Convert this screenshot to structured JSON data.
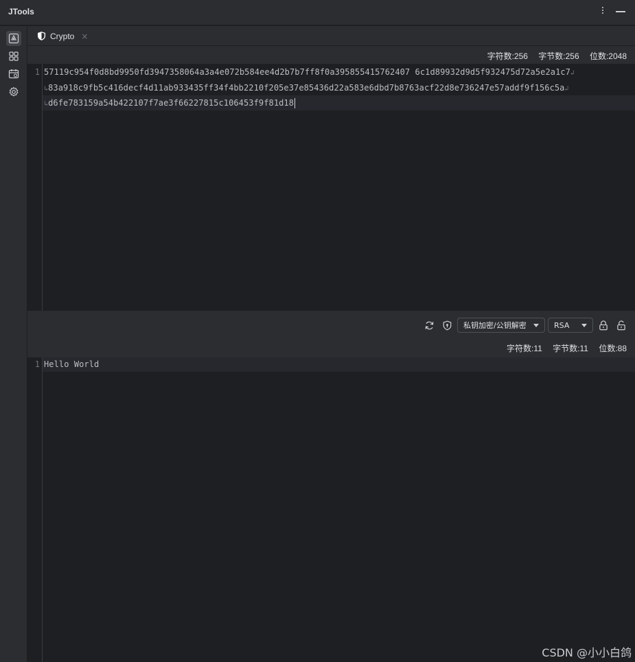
{
  "app": {
    "title": "JTools"
  },
  "sidebar": {
    "icons": [
      "crypto-icon",
      "grid-icon",
      "calendar-icon",
      "settings-icon"
    ]
  },
  "tab": {
    "label": "Crypto",
    "close": "×"
  },
  "output_panel": {
    "stats": {
      "chars": "字符数:256",
      "bytes": "字节数:256",
      "bits": "位数:2048"
    },
    "line_number": "1",
    "lines": [
      "57119c954f0d8bd9950fd3947358064a3a4e072b584ee4d2b7b7ff8f0a395855415762407 6c1d89932d9d5f932475d72a5e2a1c7",
      "83a918c9fb5c416decf4d11ab933435ff34f4bb2210f205e37e85436d22a583e6dbd7b8763acf22d8e736247e57addf9f156c5a",
      "d6fe783159a54b422107f7ae3f66227815c106453f9f81d18"
    ]
  },
  "toolbar": {
    "mode_select": "私钥加密/公钥解密",
    "algorithm_select": "RSA",
    "icons": [
      "refresh-icon",
      "shield-icon",
      "lock-icon",
      "unlock-icon"
    ]
  },
  "input_panel": {
    "stats": {
      "chars": "字符数:11",
      "bytes": "字节数:11",
      "bits": "位数:88"
    },
    "line_number": "1",
    "text": "Hello World"
  },
  "watermark": "CSDN @小小白鸽"
}
